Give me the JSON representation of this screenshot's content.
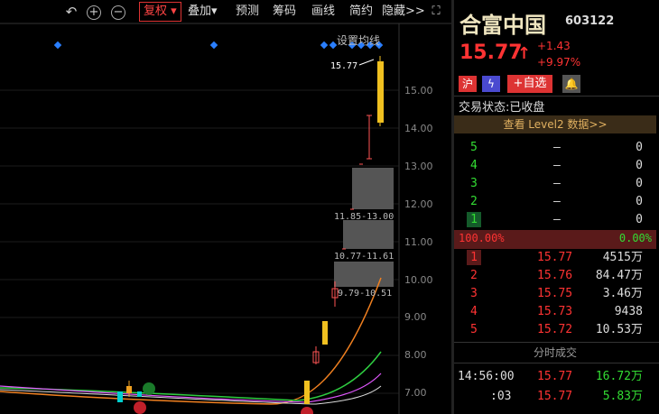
{
  "toolbar": {
    "buttons": [
      "复权",
      "叠加",
      "预测",
      "筹码",
      "画线",
      "简约",
      "隐藏>>"
    ],
    "set_ma_label": "设置均线"
  },
  "chart_data": {
    "type": "candlestick",
    "y_ticks": [
      "15.00",
      "14.00",
      "13.00",
      "12.00",
      "11.00",
      "10.00",
      "9.00",
      "8.00",
      "7.00"
    ],
    "last_price_label": "15.77",
    "zones": [
      {
        "label": "11.85-13.00",
        "low": 11.85,
        "high": 13.0
      },
      {
        "label": "10.77-11.61",
        "low": 10.77,
        "high": 11.61
      },
      {
        "label": "9.79-10.51",
        "low": 9.79,
        "high": 10.51
      }
    ]
  },
  "stock": {
    "name": "合富中国",
    "code": "603122",
    "price": "15.77",
    "change": "+1.43",
    "change_pct": "+9.97%",
    "badge_hu": "沪",
    "badge_add": "+自选",
    "status_label": "交易状态:",
    "status_value": "已收盘",
    "level2": "查看 Level2 数据>>"
  },
  "asks": [
    {
      "level": "5",
      "price": "—",
      "vol": "0"
    },
    {
      "level": "4",
      "price": "—",
      "vol": "0"
    },
    {
      "level": "3",
      "price": "—",
      "vol": "0"
    },
    {
      "level": "2",
      "price": "—",
      "vol": "0"
    },
    {
      "level": "1",
      "price": "—",
      "vol": "0"
    }
  ],
  "ratio": {
    "left": "100.00%",
    "right": "0.00%"
  },
  "bids": [
    {
      "level": "1",
      "price": "15.77",
      "vol": "4515万"
    },
    {
      "level": "2",
      "price": "15.76",
      "vol": "84.47万"
    },
    {
      "level": "3",
      "price": "15.75",
      "vol": "3.46万"
    },
    {
      "level": "4",
      "price": "15.73",
      "vol": "9438"
    },
    {
      "level": "5",
      "price": "15.72",
      "vol": "10.53万"
    }
  ],
  "ticks_title": "分时成交",
  "ticks": [
    {
      "time": "14:56:00",
      "price": "15.77",
      "vol": "16.72万"
    },
    {
      "time": ":03",
      "price": "15.77",
      "vol": "5.83万"
    }
  ]
}
